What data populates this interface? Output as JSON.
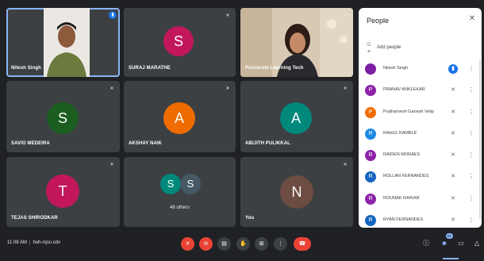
{
  "tiles": [
    {
      "name": "Nitesh Singh",
      "type": "video"
    },
    {
      "name": "SURAJ MARATHE",
      "initial": "S",
      "color": "#c2185b"
    },
    {
      "name": "Purvanshi Learning Tech",
      "type": "video"
    },
    {
      "name": "SAVIO MEDEIRA",
      "initial": "S",
      "color": "#1b5e20"
    },
    {
      "name": "AKSHAY NAIK",
      "initial": "A",
      "color": "#ef6c00"
    },
    {
      "name": "ABIJITH PULIKKAL",
      "initial": "A",
      "color": "#00897b"
    },
    {
      "name": "TEJAS SHIRODKAR",
      "initial": "T",
      "color": "#c2185b"
    },
    {
      "name": "46 others",
      "initial_a": "S",
      "initial_b": "S",
      "color_a": "#00897b",
      "color_b": "#455a64"
    },
    {
      "name": "You",
      "initial": "N",
      "color": "#6d4c41"
    }
  ],
  "panel": {
    "title": "People",
    "add_label": "Add people",
    "participants": [
      {
        "name": "Nitesh Singh",
        "initial": "",
        "color": "#7b1fa2",
        "mic": "on"
      },
      {
        "name": "PRANAV ANKLEKAR",
        "initial": "P",
        "color": "#8e24aa",
        "mic": "off"
      },
      {
        "name": "Prathamesh Ganesh Velip",
        "initial": "P",
        "color": "#ef6c00",
        "mic": "off"
      },
      {
        "name": "RAHUL KAMBLE",
        "initial": "R",
        "color": "#1e88e5",
        "mic": "off"
      },
      {
        "name": "RAIDEN MORAES",
        "initial": "R",
        "color": "#8e24aa",
        "mic": "off"
      },
      {
        "name": "ROLLAN FERNANDES",
        "initial": "R",
        "color": "#1565c0",
        "mic": "off"
      },
      {
        "name": "ROUNAK RAIKAR",
        "initial": "R",
        "color": "#8e24aa",
        "mic": "off"
      },
      {
        "name": "RYAN FERNANDES",
        "initial": "R",
        "color": "#1565c0",
        "mic": "off"
      }
    ]
  },
  "bottom": {
    "time": "11:08 AM",
    "separator": "|",
    "meeting_code": "huh-rqsc-cdv",
    "people_count": "61"
  },
  "icons": {
    "mic_off": "mic-off-icon",
    "cam_off": "camera-off-icon",
    "captions": "captions-icon",
    "hand": "raise-hand-icon",
    "present": "present-icon",
    "more": "more-vert-icon",
    "end": "end-call-icon",
    "info": "info-icon",
    "people": "people-icon",
    "chat": "chat-icon",
    "activities": "activities-icon"
  },
  "colors": {
    "accent": "#8ab4f8",
    "danger": "#ea4335",
    "meet_blue": "#1a73e8"
  }
}
